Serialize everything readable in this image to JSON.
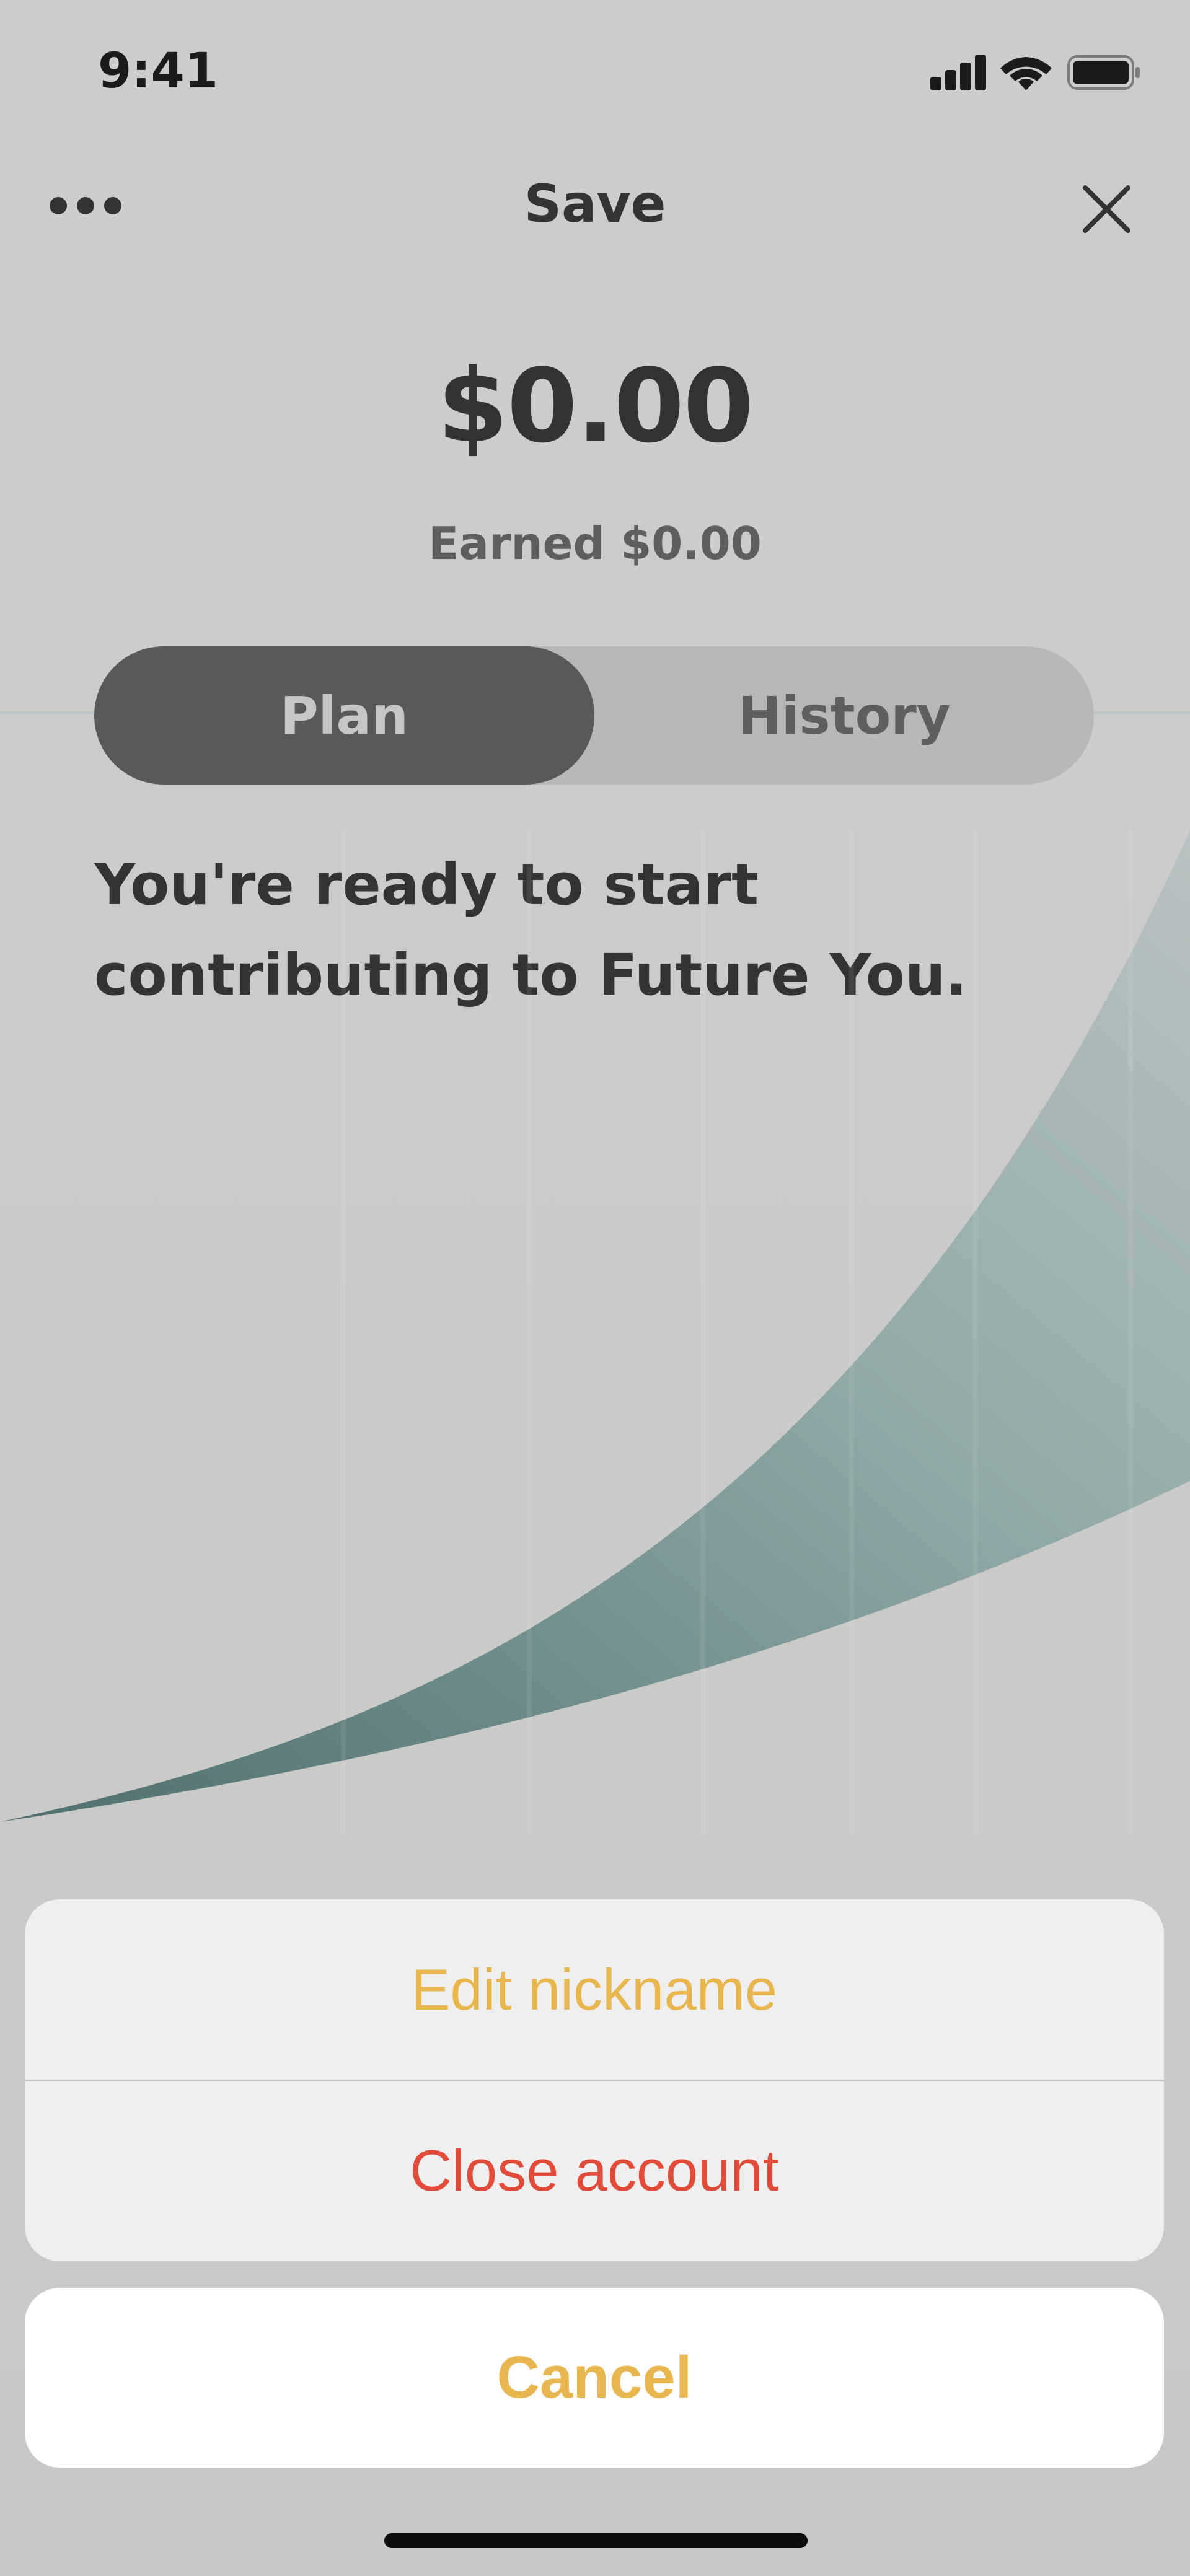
{
  "status_bar": {
    "time": "9:41",
    "icons": [
      "cellular-signal-icon",
      "wifi-icon",
      "battery-icon"
    ]
  },
  "nav": {
    "title": "Save",
    "more_icon": "more-horizontal-icon",
    "close_icon": "close-icon"
  },
  "balance": {
    "amount": "$0.00",
    "earned": "Earned $0.00"
  },
  "tabs": {
    "plan": "Plan",
    "history": "History",
    "selected": "Plan"
  },
  "message": "You're ready to start contributing to Future You.",
  "action_sheet": {
    "edit_label": "Edit nickname",
    "close_account_label": "Close account",
    "cancel_label": "Cancel"
  },
  "colors": {
    "accent": "#e8b64e",
    "destructive": "#e14c3a",
    "segment_active": "#5a5959",
    "chart_teal": "#7f9c9b"
  }
}
